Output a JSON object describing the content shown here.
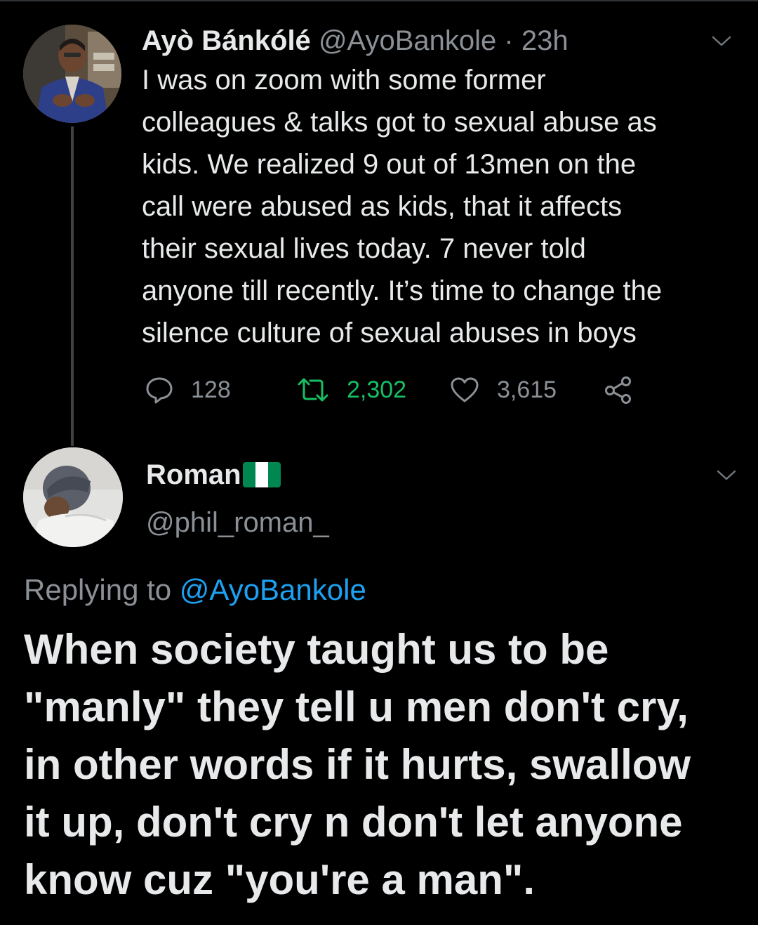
{
  "tweet": {
    "author_name": "Ayò Bánkólé",
    "author_handle": "@AyoBankole",
    "separator": "·",
    "time": "23h",
    "text_lines": [
      "I was on zoom with some former",
      "colleagues & talks got to sexual abuse as",
      "kids. We realized 9 out of 13men on the",
      "call were abused as kids, that it affects",
      "their sexual lives today. 7 never told",
      "anyone till recently. It’s time to change the",
      "silence culture of sexual abuses in boys"
    ],
    "replies": "128",
    "retweets": "2,302",
    "likes": "3,615"
  },
  "reply": {
    "author_name": "Roman",
    "author_handle": "@phil_roman_",
    "replying_to_label": "Replying to",
    "replying_to_handle": "@AyoBankole",
    "text_lines": [
      "When society taught us to be",
      "\"manly\" they tell u men don't cry,",
      "in other words if it hurts, swallow",
      "it up, don't cry n don't let anyone",
      "know cuz \"you're a man\"."
    ]
  },
  "icons": {
    "reply": "speech-bubble-icon",
    "retweet": "retweet-icon",
    "like": "heart-icon",
    "share": "share-icon",
    "caret": "chevron-down-icon",
    "flag": "nigeria-flag-icon"
  },
  "colors": {
    "background": "#000000",
    "text": "#e7e9ea",
    "secondary": "#8b9096",
    "link": "#1da1f2",
    "retweet_active": "#17bf63",
    "flag_green": "#008751",
    "flag_white": "#ffffff"
  }
}
